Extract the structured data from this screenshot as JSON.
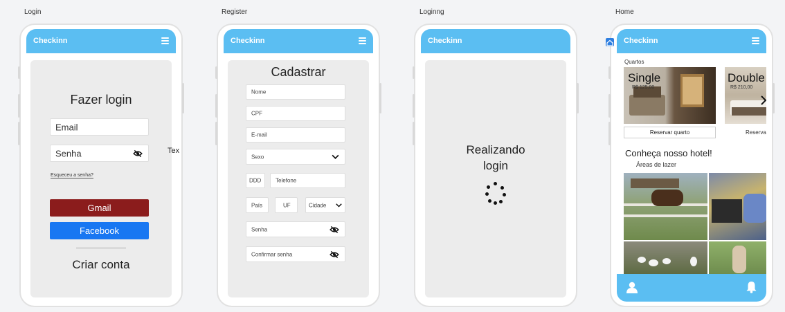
{
  "frames": {
    "login": "Login",
    "register": "Register",
    "loading": "Loginng",
    "home": "Home"
  },
  "app_name": "Checkinn",
  "login": {
    "title": "Fazer login",
    "email_placeholder": "Email",
    "password_placeholder": "Senha",
    "forgot_link": "Esqueceu a senha?",
    "gmail_button": "Gmail",
    "facebook_button": "Facebook",
    "create_account": "Criar conta",
    "stray_text": "Tex"
  },
  "register": {
    "title": "Cadastrar",
    "name": "Nome",
    "cpf": "CPF",
    "email": "E-mail",
    "sex": "Sexo",
    "ddd": "DDD",
    "phone": "Telefone",
    "country": "País",
    "state": "UF",
    "city": "Cidade",
    "password": "Senha",
    "confirm_password": "Confirmar senha"
  },
  "loading": {
    "line1": "Realizando",
    "line2": "login"
  },
  "home": {
    "rooms_label": "Quartos",
    "rooms": [
      {
        "name": "Single",
        "price": "R$ 125,00",
        "button": "Reservar quarto"
      },
      {
        "name": "Double",
        "price": "R$ 210,00",
        "button": "Reservar"
      }
    ],
    "hotel_heading": "Conheça nosso hotel!",
    "leisure_label": "Áreas de lazer"
  },
  "colors": {
    "appbar": "#5bbef2",
    "gmail": "#8b1c1c",
    "facebook": "#1877f2"
  }
}
